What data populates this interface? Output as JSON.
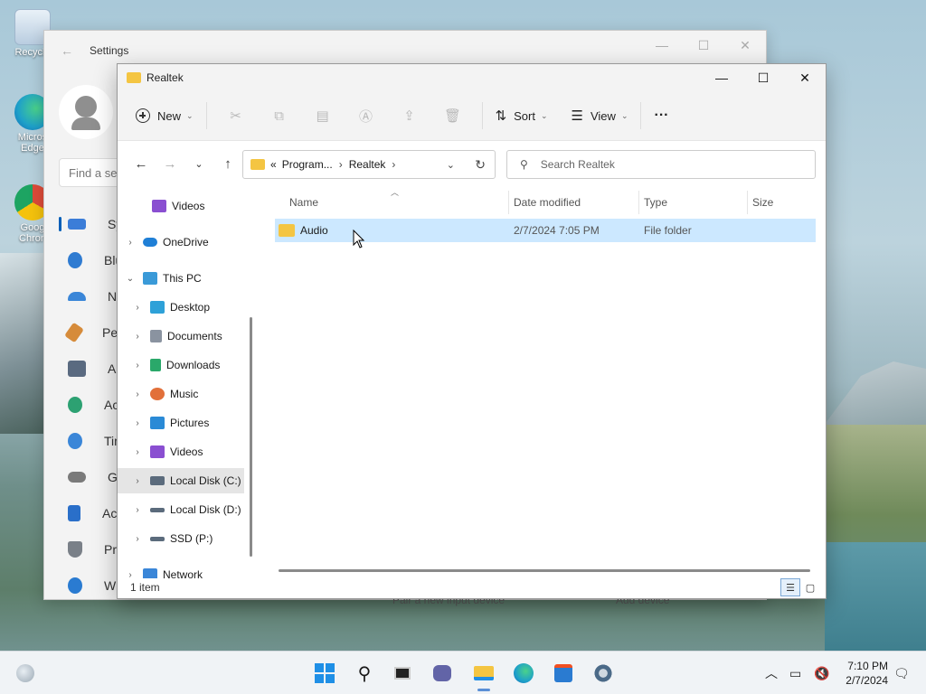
{
  "desktop": {
    "icons": [
      {
        "label": "Recycle",
        "icon": "recycle-bin-icon",
        "color": "#7aa8d8"
      },
      {
        "label": "Micros\nEdge",
        "icon": "edge-icon",
        "color": "#1ea0c9"
      },
      {
        "label": "Goog\nChron",
        "icon": "chrome-icon",
        "color": "#dd4b39"
      }
    ]
  },
  "settings": {
    "title": "Settings",
    "search_placeholder": "Find a se",
    "nav": [
      {
        "label": "Syst",
        "icon": "system-icon",
        "color": "#3b7dd8"
      },
      {
        "label": "Blue",
        "icon": "bluetooth-icon",
        "color": "#2f7bd1"
      },
      {
        "label": "Net",
        "icon": "network-icon",
        "color": "#3a86d8"
      },
      {
        "label": "Pers",
        "icon": "personalization-icon",
        "color": "#d68b3a"
      },
      {
        "label": "App",
        "icon": "apps-icon",
        "color": "#5a6a80"
      },
      {
        "label": "Acc",
        "icon": "accounts-icon",
        "color": "#2da172"
      },
      {
        "label": "Tim",
        "icon": "time-icon",
        "color": "#3a86d8"
      },
      {
        "label": "Gar",
        "icon": "gaming-icon",
        "color": "#7a7a7a"
      },
      {
        "label": "Acc",
        "icon": "accessibility-icon",
        "color": "#2a6fc9"
      },
      {
        "label": "Priv",
        "icon": "privacy-icon",
        "color": "#7a8088"
      },
      {
        "label": "Win",
        "icon": "windows-update-icon",
        "color": "#2a7bd1"
      }
    ],
    "footer_left": "Pair a new input device",
    "footer_right": "Add device"
  },
  "explorer": {
    "title": "Realtek",
    "toolbar": {
      "new_label": "New",
      "sort_label": "Sort",
      "view_label": "View",
      "more_label": "···"
    },
    "address": {
      "prefix": "«",
      "crumbs": [
        "Program...",
        "Realtek"
      ]
    },
    "search_placeholder": "Search Realtek",
    "nav_pane": [
      {
        "label": "Videos",
        "icon": "videos-icon",
        "color": "#8a4fd1",
        "indent": 1,
        "chevron": "",
        "selected": false
      },
      {
        "label": "OneDrive",
        "icon": "onedrive-icon",
        "color": "#1f7fd6",
        "indent": 0,
        "chevron": "›",
        "selected": false
      },
      {
        "label": "This PC",
        "icon": "this-pc-icon",
        "color": "#3a9ad8",
        "indent": 0,
        "chevron": "⌄",
        "selected": false
      },
      {
        "label": "Desktop",
        "icon": "desktop-icon",
        "color": "#2ea1d8",
        "indent": 1,
        "chevron": "›",
        "selected": false
      },
      {
        "label": "Documents",
        "icon": "documents-icon",
        "color": "#8a93a0",
        "indent": 1,
        "chevron": "›",
        "selected": false
      },
      {
        "label": "Downloads",
        "icon": "downloads-icon",
        "color": "#2aa86a",
        "indent": 1,
        "chevron": "›",
        "selected": false
      },
      {
        "label": "Music",
        "icon": "music-icon",
        "color": "#e2703a",
        "indent": 1,
        "chevron": "›",
        "selected": false
      },
      {
        "label": "Pictures",
        "icon": "pictures-icon",
        "color": "#2a8ad6",
        "indent": 1,
        "chevron": "›",
        "selected": false
      },
      {
        "label": "Videos",
        "icon": "videos-icon",
        "color": "#8a4fd1",
        "indent": 1,
        "chevron": "›",
        "selected": false
      },
      {
        "label": "Local Disk (C:)",
        "icon": "local-disk-icon",
        "color": "#5b6b7c",
        "indent": 1,
        "chevron": "›",
        "selected": true
      },
      {
        "label": "Local Disk (D:)",
        "icon": "local-disk-icon",
        "color": "#5b6b7c",
        "indent": 1,
        "chevron": "›",
        "selected": false
      },
      {
        "label": "SSD (P:)",
        "icon": "drive-icon",
        "color": "#5b6b7c",
        "indent": 1,
        "chevron": "›",
        "selected": false
      },
      {
        "label": "Network",
        "icon": "network-icon",
        "color": "#3a86d8",
        "indent": 0,
        "chevron": "›",
        "selected": false
      }
    ],
    "columns": [
      "Name",
      "Date modified",
      "Type",
      "Size"
    ],
    "files": [
      {
        "name": "Audio",
        "date": "2/7/2024 7:05 PM",
        "type": "File folder",
        "size": ""
      }
    ],
    "status": "1 item"
  },
  "taskbar": {
    "time": "7:10 PM",
    "date": "2/7/2024",
    "apps": [
      {
        "name": "start-icon",
        "color": "#1f8fe6"
      },
      {
        "name": "search-icon",
        "color": "#222222"
      },
      {
        "name": "task-view-icon",
        "color": "#222222"
      },
      {
        "name": "chat-icon",
        "color": "#6264a7"
      },
      {
        "name": "file-explorer-icon",
        "color": "#f4c542"
      },
      {
        "name": "edge-icon",
        "color": "#1ea0c9"
      },
      {
        "name": "store-icon",
        "color": "#2a7bd1"
      },
      {
        "name": "settings-icon",
        "color": "#4b6a88"
      }
    ]
  },
  "colors": {
    "accent": "#005fb8",
    "selection": "#cce8ff"
  }
}
